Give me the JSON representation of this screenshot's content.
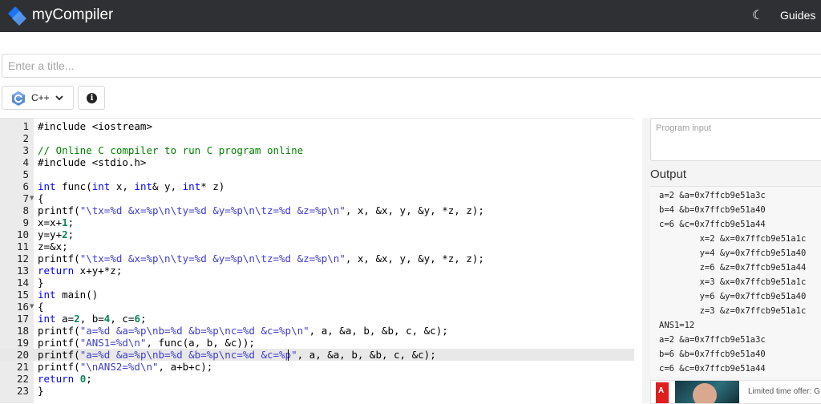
{
  "app": {
    "brand": "myCompiler",
    "guides_label": "Guides"
  },
  "colors": {
    "topbar": "#2f3033",
    "logo": "#1e74f2",
    "keyword": "#0000ff",
    "comment": "#008000",
    "string": "#3d3dd0",
    "number": "#098658"
  },
  "title_field": {
    "placeholder": "Enter a title...",
    "value": ""
  },
  "toolbar": {
    "language": "C++",
    "language_icon": "cpp-icon",
    "info_icon": "info-icon"
  },
  "editor": {
    "active_line": 20,
    "lines": [
      {
        "n": 1,
        "text": "#include <iostream>"
      },
      {
        "n": 2,
        "text": ""
      },
      {
        "n": 3,
        "text": "// Online C compiler to run C program online"
      },
      {
        "n": 4,
        "text": "#include <stdio.h>"
      },
      {
        "n": 5,
        "text": ""
      },
      {
        "n": 6,
        "text": "int func(int x, int& y, int* z)"
      },
      {
        "n": 7,
        "text": "{",
        "fold": true
      },
      {
        "n": 8,
        "text": "printf(\"\\tx=%d &x=%p\\n\\ty=%d &y=%p\\n\\tz=%d &z=%p\\n\", x, &x, y, &y, *z, z);"
      },
      {
        "n": 9,
        "text": "x=x+1;"
      },
      {
        "n": 10,
        "text": "y=y+2;"
      },
      {
        "n": 11,
        "text": "z=&x;"
      },
      {
        "n": 12,
        "text": "printf(\"\\tx=%d &x=%p\\n\\ty=%d &y=%p\\n\\tz=%d &z=%p\\n\", x, &x, y, &y, *z, z);"
      },
      {
        "n": 13,
        "text": "return x+y+*z;"
      },
      {
        "n": 14,
        "text": "}"
      },
      {
        "n": 15,
        "text": "int main()"
      },
      {
        "n": 16,
        "text": "{",
        "fold": true
      },
      {
        "n": 17,
        "text": "int a=2, b=4, c=6;"
      },
      {
        "n": 18,
        "text": "printf(\"a=%d &a=%p\\nb=%d &b=%p\\nc=%d &c=%p\\n\", a, &a, b, &b, c, &c);"
      },
      {
        "n": 19,
        "text": "printf(\"ANS1=%d\\n\", func(a, b, &c));"
      },
      {
        "n": 20,
        "text": "printf(\"a=%d &a=%p\\nb=%d &b=%p\\nc=%d &c=%p\", a, &a, b, &b, c, &c);"
      },
      {
        "n": 21,
        "text": "printf(\"\\nANS2=%d\\n\", a+b+c);"
      },
      {
        "n": 22,
        "text": "return 0;"
      },
      {
        "n": 23,
        "text": "}"
      }
    ]
  },
  "program_input": {
    "placeholder": "Program input",
    "value": ""
  },
  "output": {
    "title": "Output",
    "lines": [
      "a=2 &a=0x7ffcb9e51a3c",
      "b=4 &b=0x7ffcb9e51a40",
      "c=6 &c=0x7ffcb9e51a44",
      "        x=2 &x=0x7ffcb9e51a1c",
      "        y=4 &y=0x7ffcb9e51a40",
      "        z=6 &z=0x7ffcb9e51a44",
      "        x=3 &x=0x7ffcb9e51a1c",
      "        y=6 &y=0x7ffcb9e51a40",
      "        z=3 &z=0x7ffcb9e51a1c",
      "ANS1=12",
      "a=2 &a=0x7ffcb9e51a3c",
      "b=6 &b=0x7ffcb9e51a40",
      "c=6 &c=0x7ffcb9e51a44"
    ]
  },
  "ad": {
    "logo_text": "A",
    "text": "Limited time offer: G"
  }
}
